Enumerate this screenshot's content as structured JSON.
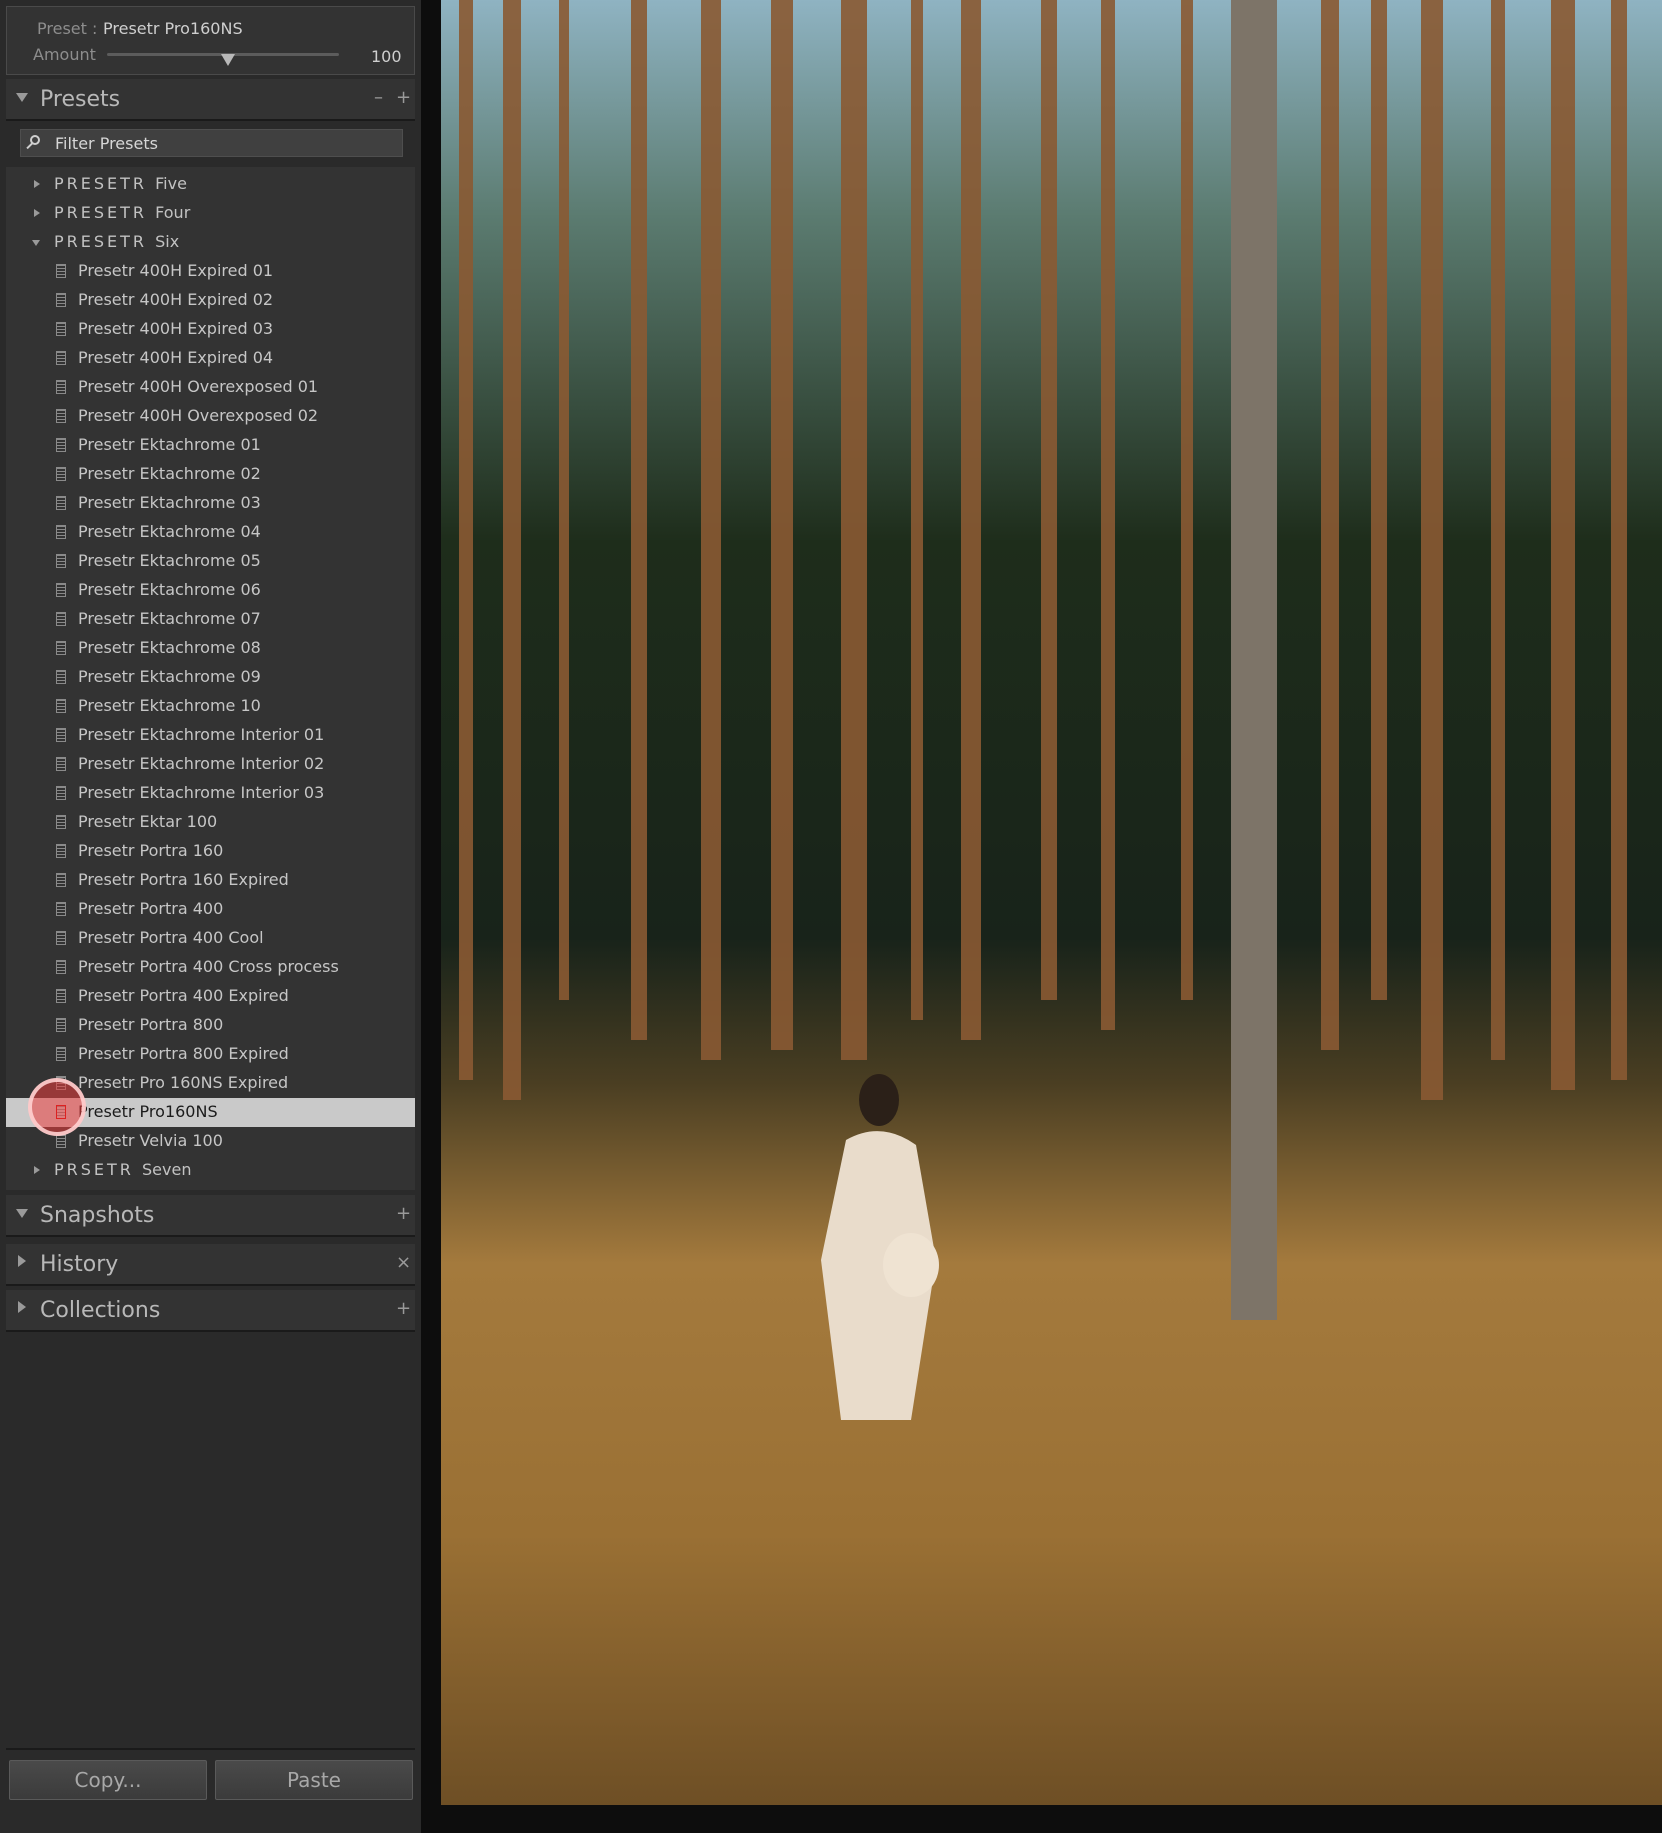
{
  "preset_box": {
    "preset_label": "Preset :",
    "preset_value": "Presetr Pro160NS",
    "amount_label": "Amount",
    "amount_value": "100"
  },
  "presets": {
    "title": "Presets",
    "minus": "–",
    "plus": "+",
    "filter_placeholder": "Filter Presets",
    "folders": [
      {
        "prefix": "PRESETR",
        "name": "Five"
      },
      {
        "prefix": "PRESETR",
        "name": "Four"
      },
      {
        "prefix": "PRESETR",
        "name": "Six"
      },
      {
        "prefix": "PRSETR",
        "name": "Seven"
      }
    ],
    "items": [
      "Presetr 400H Expired 01",
      "Presetr 400H Expired 02",
      "Presetr 400H Expired 03",
      "Presetr 400H Expired 04",
      "Presetr 400H Overexposed 01",
      "Presetr 400H Overexposed 02",
      "Presetr Ektachrome 01",
      "Presetr Ektachrome 02",
      "Presetr Ektachrome 03",
      "Presetr Ektachrome 04",
      "Presetr Ektachrome 05",
      "Presetr Ektachrome 06",
      "Presetr Ektachrome 07",
      "Presetr Ektachrome 08",
      "Presetr Ektachrome 09",
      "Presetr Ektachrome 10",
      "Presetr Ektachrome Interior 01",
      "Presetr Ektachrome Interior 02",
      "Presetr Ektachrome Interior 03",
      "Presetr Ektar 100",
      "Presetr Portra 160",
      "Presetr Portra 160 Expired",
      "Presetr Portra 400",
      "Presetr Portra 400 Cool",
      "Presetr Portra 400 Cross process",
      "Presetr Portra 400 Expired",
      "Presetr Portra 800",
      "Presetr Portra 800 Expired",
      "Presetr Pro 160NS Expired",
      "Presetr Pro160NS",
      "Presetr Velvia 100"
    ],
    "selected": "Presetr Pro160NS"
  },
  "snapshots": {
    "title": "Snapshots",
    "action": "+"
  },
  "history": {
    "title": "History",
    "action": "×"
  },
  "collections": {
    "title": "Collections",
    "action": "+"
  },
  "buttons": {
    "copy": "Copy...",
    "paste": "Paste"
  }
}
